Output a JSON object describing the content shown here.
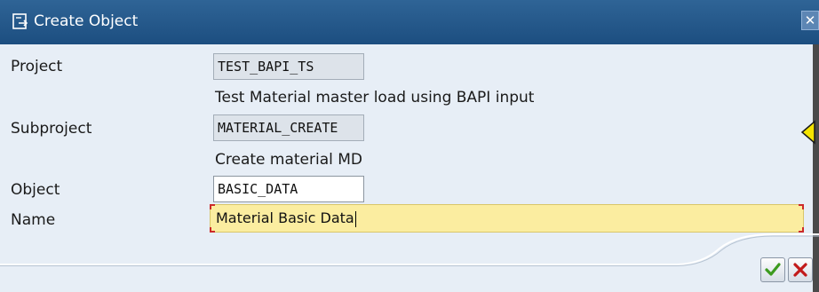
{
  "window": {
    "title": "Create Object",
    "title_icon": "create-object-icon",
    "close_icon": "close-icon",
    "close_glyph": "✕"
  },
  "form": {
    "project": {
      "label": "Project",
      "value": "TEST_BAPI_TS",
      "description": "Test Material master load using BAPI input"
    },
    "subproject": {
      "label": "Subproject",
      "value": "MATERIAL_CREATE",
      "description": "Create material MD"
    },
    "object": {
      "label": "Object",
      "value": "BASIC_DATA"
    },
    "name": {
      "label": "Name",
      "value": "Material Basic Data"
    }
  },
  "buttons": {
    "ok_icon": "checkmark-icon",
    "cancel_icon": "cancel-x-icon"
  },
  "colors": {
    "titlebar": "#1c4e80",
    "dialog_bg": "#e7eef6",
    "required_field": "#fbeda0",
    "ok_green": "#3c9a1e",
    "cancel_red": "#c21a1a",
    "marker_yellow": "#f5e400"
  }
}
